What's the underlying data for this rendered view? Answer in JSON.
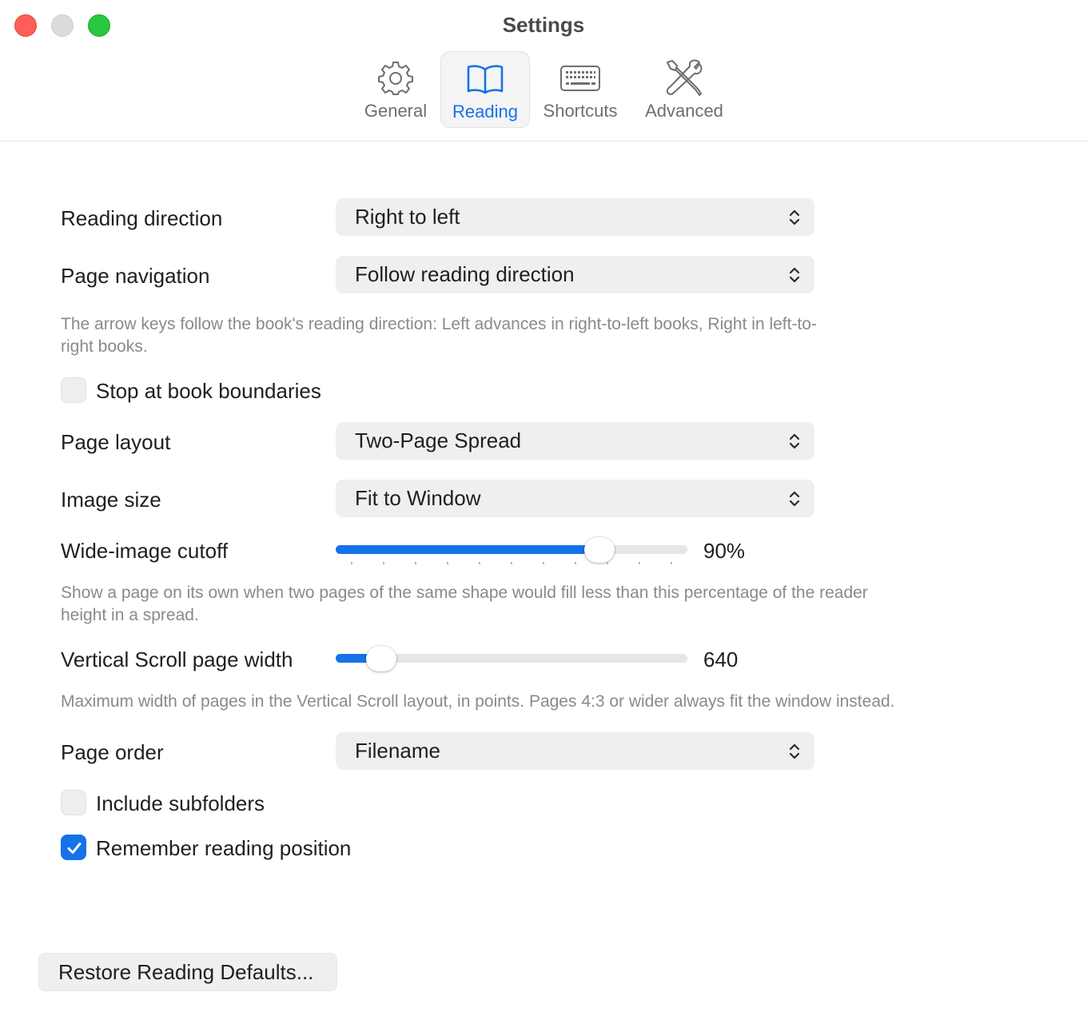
{
  "window": {
    "title": "Settings",
    "colors": {
      "accent": "#1572e8",
      "close": "#fe5f57",
      "zoom": "#28c840",
      "minimize_inactive": "#dcdcdc"
    }
  },
  "tabs": [
    {
      "label": "General",
      "icon": "gear-icon",
      "active": false
    },
    {
      "label": "Reading",
      "icon": "book-icon",
      "active": true
    },
    {
      "label": "Shortcuts",
      "icon": "keyboard-icon",
      "active": false
    },
    {
      "label": "Advanced",
      "icon": "tools-icon",
      "active": false
    }
  ],
  "reading": {
    "reading_direction": {
      "label": "Reading direction",
      "value": "Right to left"
    },
    "page_navigation": {
      "label": "Page navigation",
      "value": "Follow reading direction",
      "help_line1": "The arrow keys follow the book's reading direction: Left advances in right-to-left books, Right in left-to-",
      "help_line2": "right books."
    },
    "stop_at_boundaries": {
      "label": "Stop at book boundaries",
      "checked": false
    },
    "page_layout": {
      "label": "Page layout",
      "value": "Two-Page Spread"
    },
    "image_size": {
      "label": "Image size",
      "value": "Fit to Window"
    },
    "wide_image_cutoff": {
      "label": "Wide-image cutoff",
      "value_text": "90%",
      "fraction": 0.75,
      "help_line1": "Show a page on its own when two pages of the same shape would fill less than this percentage of the reader",
      "help_line2": "height in a spread."
    },
    "vertical_scroll_width": {
      "label": "Vertical Scroll page width",
      "value_text": "640",
      "fraction": 0.13,
      "help": "Maximum width of pages in the Vertical Scroll layout, in points. Pages 4:3 or wider always fit the window instead."
    },
    "page_order": {
      "label": "Page order",
      "value": "Filename"
    },
    "include_subfolders": {
      "label": "Include subfolders",
      "checked": false
    },
    "remember_position": {
      "label": "Remember reading position",
      "checked": true
    },
    "restore_button": "Restore Reading Defaults..."
  }
}
